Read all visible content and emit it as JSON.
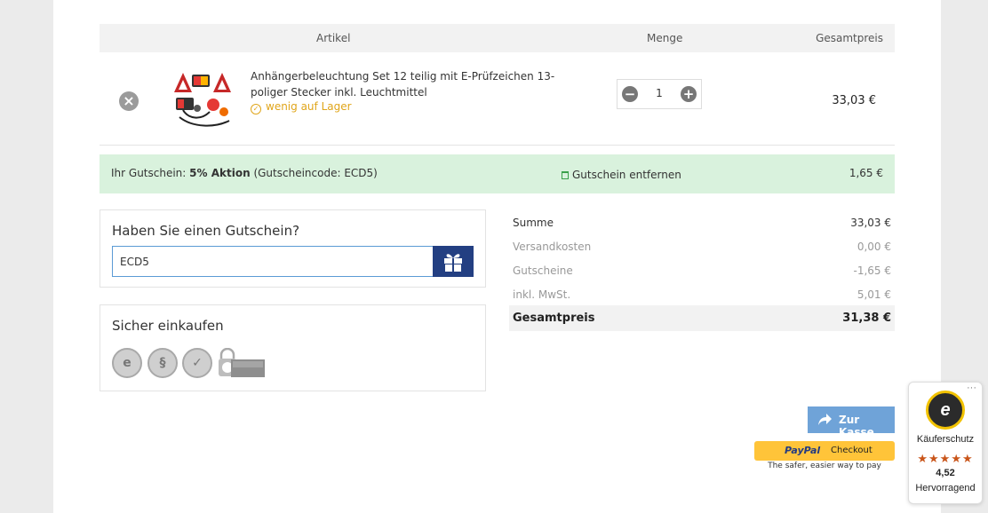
{
  "table": {
    "headers": {
      "article": "Artikel",
      "quantity": "Menge",
      "total": "Gesamtpreis"
    },
    "item": {
      "name": "Anhängerbeleuchtung Set 12 teilig mit E-Prüfzeichen 13-poliger Stecker inkl. Leuchtmittel",
      "stock": "wenig auf Lager",
      "quantity": "1",
      "price": "33,03 €"
    }
  },
  "voucher_applied": {
    "prefix": "Ihr Gutschein:",
    "name": "5% Aktion",
    "code_text": "(Gutscheincode: ECD5)",
    "remove_label": "Gutschein entfernen",
    "amount": "1,65 €"
  },
  "voucher_box": {
    "title": "Haben Sie einen Gutschein?",
    "input_value": "ECD5"
  },
  "secure": {
    "title": "Sicher einkaufen"
  },
  "summary": {
    "rows": [
      {
        "label": "Summe",
        "value": "33,03 €"
      },
      {
        "label": "Versandkosten",
        "value": "0,00 €"
      },
      {
        "label": "Gutscheine",
        "value": "-1,65 €"
      },
      {
        "label": "inkl. MwSt.",
        "value": "5,01 €"
      }
    ],
    "total_label": "Gesamtpreis",
    "total_value": "31,38 €"
  },
  "checkout": {
    "label": "Zur Kasse",
    "paypal_brand": "PayPal",
    "paypal_label": "Checkout",
    "paypal_sub": "The safer, easier way to pay"
  },
  "trusted_shops": {
    "label": "Käuferschutz",
    "stars": "★★★★★",
    "rating": "4,52",
    "text": "Hervorragend"
  },
  "colors": {
    "voucher_bg": "#d9f2dd",
    "voucher_button": "#233f82",
    "checkout_button": "#6fa3d8",
    "stock": "#e0a51a",
    "paypal": "#ffc439"
  }
}
